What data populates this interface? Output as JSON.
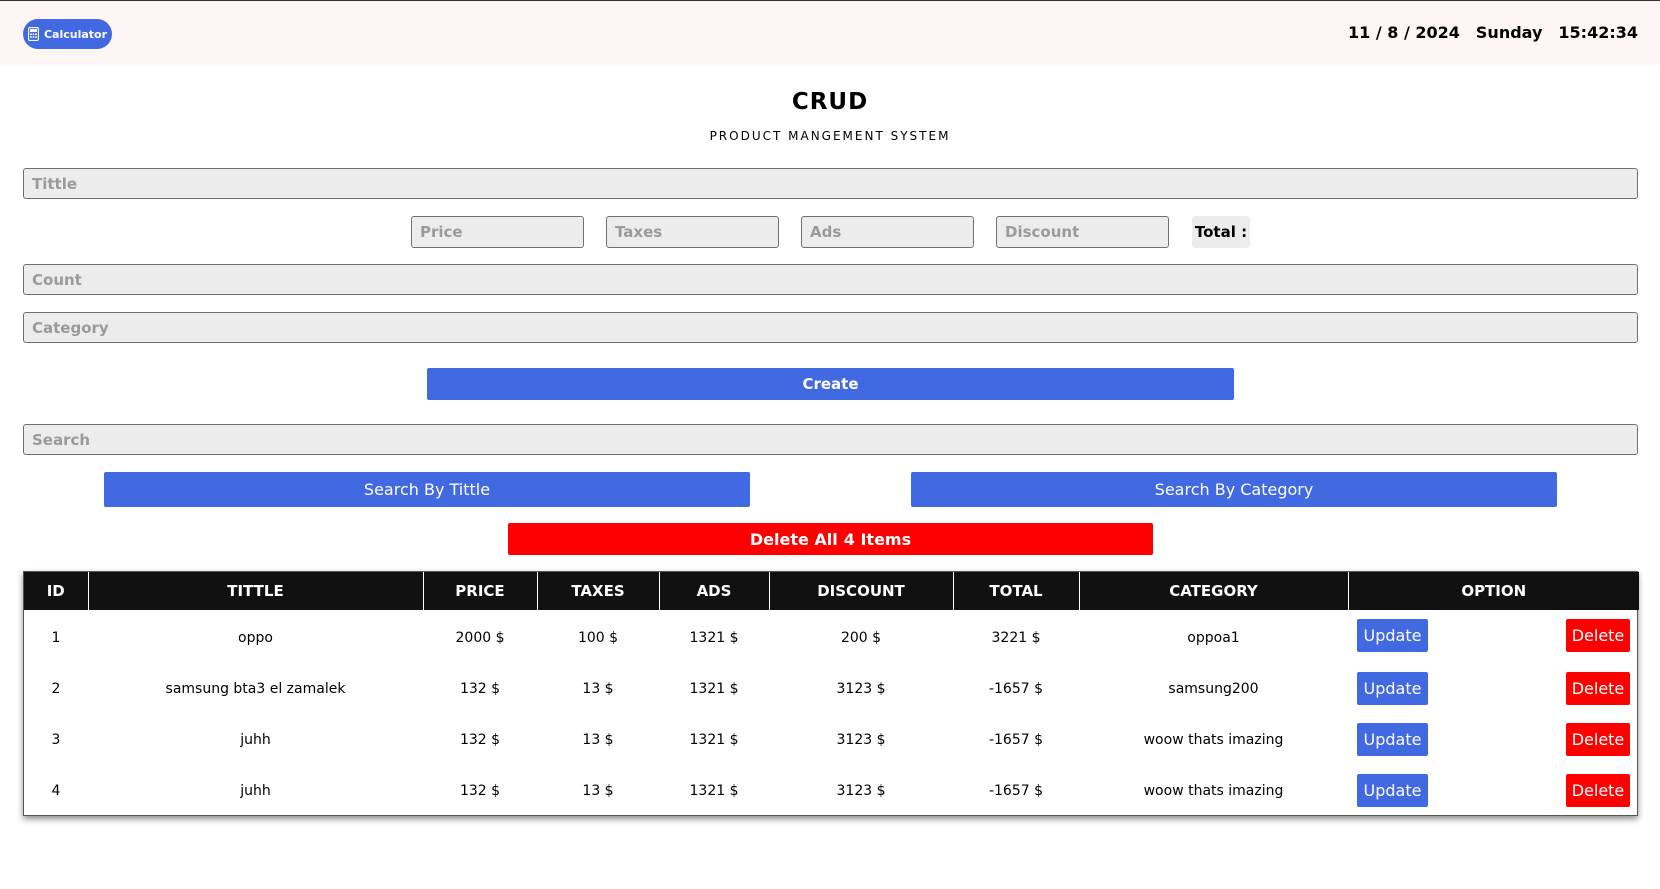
{
  "topbar": {
    "calculator_label": "Calculator",
    "date": "11 / 8 / 2024",
    "day": "Sunday",
    "time": "15:42:34"
  },
  "header": {
    "title": "CRUD",
    "subtitle": "PRODUCT MANGEMENT SYSTEM"
  },
  "form": {
    "title_placeholder": "Tittle",
    "price_placeholder": "Price",
    "taxes_placeholder": "Taxes",
    "ads_placeholder": "Ads",
    "discount_placeholder": "Discount",
    "total_label": "Total :",
    "count_placeholder": "Count",
    "category_placeholder": "Category",
    "create_label": "Create"
  },
  "search": {
    "placeholder": "Search",
    "by_title_label": "Search By Tittle",
    "by_category_label": "Search By Category",
    "delete_all_label": "Delete All",
    "delete_all_count": "4 Items"
  },
  "table": {
    "headers": [
      "ID",
      "TITTLE",
      "PRICE",
      "TAXES",
      "ADS",
      "DISCOUNT",
      "TOTAL",
      "CATEGORY",
      "OPTION"
    ],
    "update_label": "Update",
    "delete_label": "Delete",
    "rows": [
      {
        "id": "1",
        "title": "oppo",
        "price": "2000 $",
        "taxes": "100 $",
        "ads": "1321 $",
        "discount": "200 $",
        "total": "3221 $",
        "category": "oppoa1"
      },
      {
        "id": "2",
        "title": "samsung bta3 el zamalek",
        "price": "132 $",
        "taxes": "13 $",
        "ads": "1321 $",
        "discount": "3123 $",
        "total": "-1657 $",
        "category": "samsung200"
      },
      {
        "id": "3",
        "title": "juhh",
        "price": "132 $",
        "taxes": "13 $",
        "ads": "1321 $",
        "discount": "3123 $",
        "total": "-1657 $",
        "category": "woow thats imazing"
      },
      {
        "id": "4",
        "title": "juhh",
        "price": "132 $",
        "taxes": "13 $",
        "ads": "1321 $",
        "discount": "3123 $",
        "total": "-1657 $",
        "category": "woow thats imazing"
      }
    ]
  },
  "colors": {
    "primary": "#4169e1",
    "danger": "#ff0000",
    "header_bg": "#111111",
    "topbar_bg": "#fdf6f4",
    "input_bg": "#ececec"
  }
}
